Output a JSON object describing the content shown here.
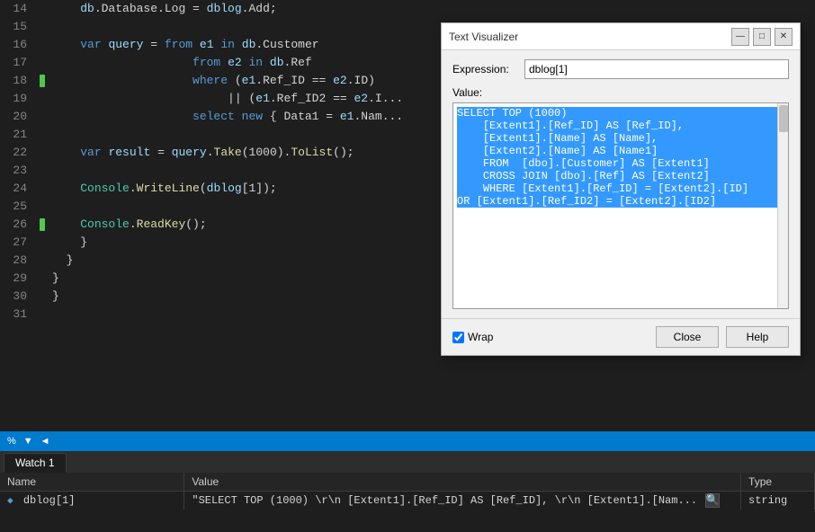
{
  "dialog": {
    "title": "Text Visualizer",
    "expression_label": "Expression:",
    "expression_value": "dblog[1]",
    "value_label": "Value:",
    "sql_content": "SELECT TOP (1000)\n    [Extent1].[Ref_ID] AS [Ref_ID],\n    [Extent1].[Name] AS [Name],\n    [Extent2].[Name] AS [Name1]\n    FROM  [dbo].[Customer] AS [Extent1]\n    CROSS JOIN [dbo].[Ref] AS [Extent2]\n    WHERE [Extent1].[Ref_ID] = [Extent2].[ID]\nOR [Extent1].[Ref_ID2] = [Extent2].[ID2]",
    "wrap_label": "Wrap",
    "close_label": "Close",
    "help_label": "Help"
  },
  "code_lines": [
    {
      "num": "14",
      "indicator": false,
      "content": "    db.Database.Log = dblog.Add;"
    },
    {
      "num": "15",
      "indicator": false,
      "content": ""
    },
    {
      "num": "16",
      "indicator": false,
      "content": "    var query = from e1 in db.Customer"
    },
    {
      "num": "17",
      "indicator": false,
      "content": "                    from e2 in db.Ref"
    },
    {
      "num": "18",
      "indicator": true,
      "content": "                    where (e1.Ref_ID == e2.ID)"
    },
    {
      "num": "19",
      "indicator": false,
      "content": "                         || (e1.Ref_ID2 == e2.I..."
    },
    {
      "num": "20",
      "indicator": false,
      "content": "                    select new { Data1 = e1.Nam..."
    },
    {
      "num": "21",
      "indicator": false,
      "content": ""
    },
    {
      "num": "22",
      "indicator": false,
      "content": "    var result = query.Take(1000).ToList();"
    },
    {
      "num": "23",
      "indicator": false,
      "content": ""
    },
    {
      "num": "24",
      "indicator": false,
      "content": "    Console.WriteLine(dblog[1]);"
    },
    {
      "num": "25",
      "indicator": false,
      "content": ""
    },
    {
      "num": "26",
      "indicator": true,
      "content": "    Console.ReadKey();"
    },
    {
      "num": "27",
      "indicator": false,
      "content": "    }"
    },
    {
      "num": "28",
      "indicator": false,
      "content": "  }"
    },
    {
      "num": "29",
      "indicator": false,
      "content": "}"
    },
    {
      "num": "30",
      "indicator": false,
      "content": "}"
    },
    {
      "num": "31",
      "indicator": false,
      "content": ""
    }
  ],
  "status_bar": {
    "zoom": "%",
    "arrow": "▼"
  },
  "watch_panel": {
    "tab_label": "Watch 1",
    "columns": [
      "Name",
      "Value",
      "Type"
    ],
    "rows": [
      {
        "name": "dblog[1]",
        "icon": "◆",
        "value": "\"SELECT TOP (1000) \\r\\n    [Extent1].[Ref_ID] AS [Ref_ID], \\r\\n    [Extent1].[Nam...",
        "type": "string"
      }
    ]
  }
}
